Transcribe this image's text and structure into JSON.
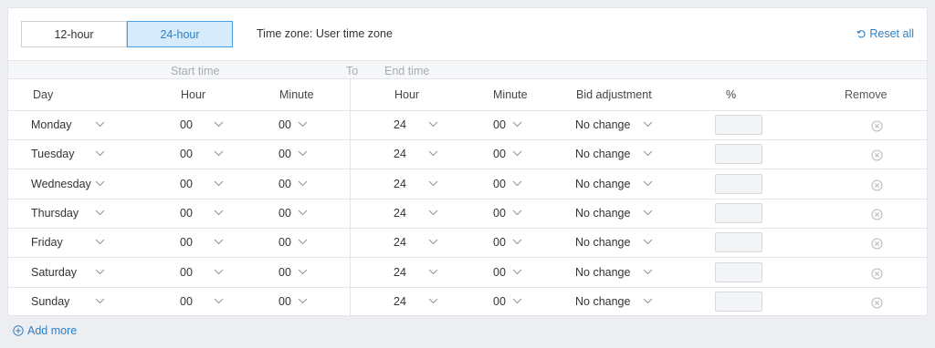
{
  "format_toggle": {
    "option_12": "12-hour",
    "option_24": "24-hour",
    "selected": "24-hour"
  },
  "timezone_text": "Time zone: User time zone",
  "reset_label": "Reset all",
  "subheader": {
    "start": "Start time",
    "to": "To",
    "end": "End time"
  },
  "columns": {
    "day": "Day",
    "start_hour": "Hour",
    "start_minute": "Minute",
    "end_hour": "Hour",
    "end_minute": "Minute",
    "bid": "Bid adjustment",
    "pct": "%",
    "remove": "Remove"
  },
  "rows": [
    {
      "day": "Monday",
      "start_hour": "00",
      "start_minute": "00",
      "end_hour": "24",
      "end_minute": "00",
      "bid": "No change",
      "pct": ""
    },
    {
      "day": "Tuesday",
      "start_hour": "00",
      "start_minute": "00",
      "end_hour": "24",
      "end_minute": "00",
      "bid": "No change",
      "pct": ""
    },
    {
      "day": "Wednesday",
      "start_hour": "00",
      "start_minute": "00",
      "end_hour": "24",
      "end_minute": "00",
      "bid": "No change",
      "pct": ""
    },
    {
      "day": "Thursday",
      "start_hour": "00",
      "start_minute": "00",
      "end_hour": "24",
      "end_minute": "00",
      "bid": "No change",
      "pct": ""
    },
    {
      "day": "Friday",
      "start_hour": "00",
      "start_minute": "00",
      "end_hour": "24",
      "end_minute": "00",
      "bid": "No change",
      "pct": ""
    },
    {
      "day": "Saturday",
      "start_hour": "00",
      "start_minute": "00",
      "end_hour": "24",
      "end_minute": "00",
      "bid": "No change",
      "pct": ""
    },
    {
      "day": "Sunday",
      "start_hour": "00",
      "start_minute": "00",
      "end_hour": "24",
      "end_minute": "00",
      "bid": "No change",
      "pct": ""
    }
  ],
  "add_more_label": "Add more",
  "colors": {
    "accent": "#2d7fc4",
    "selected_bg": "#d6ecfb",
    "border": "#e3e5e8",
    "muted": "#a6abb2"
  },
  "icons": {
    "reset": "rotate-ccw-icon",
    "chevron": "chevron-down-icon",
    "remove": "circle-x-icon",
    "add": "plus-circle-icon"
  }
}
